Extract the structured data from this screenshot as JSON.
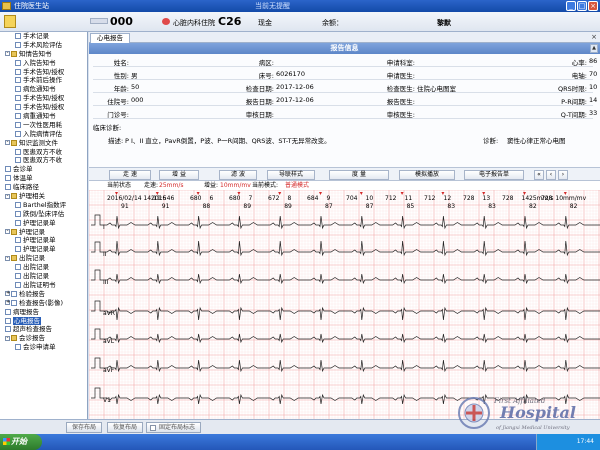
{
  "window": {
    "title": "住院医生站",
    "center_title": "当前无提醒"
  },
  "patient_bar": {
    "bed": "000",
    "dept": "心脏内科住院",
    "ward": "C26",
    "pay_type": "现金",
    "balance_label": "余额：",
    "name": "黎默"
  },
  "sidebar": {
    "items": [
      {
        "label": "手术记录",
        "indent": 3,
        "icon": "doc-icon",
        "expander": ""
      },
      {
        "label": "手术风险评估",
        "indent": 3,
        "icon": "doc-icon",
        "expander": ""
      },
      {
        "label": "知情告知书",
        "indent": 1,
        "icon": "folder-icon",
        "expander": "-"
      },
      {
        "label": "入院告知书",
        "indent": 3,
        "icon": "doc-icon",
        "expander": ""
      },
      {
        "label": "手术告知/授权",
        "indent": 3,
        "icon": "doc-icon",
        "expander": ""
      },
      {
        "label": "手术前后操作",
        "indent": 3,
        "icon": "doc-icon",
        "expander": ""
      },
      {
        "label": "病危通知书",
        "indent": 3,
        "icon": "doc-icon",
        "expander": ""
      },
      {
        "label": "手术告知/授权",
        "indent": 3,
        "icon": "doc-icon",
        "expander": ""
      },
      {
        "label": "手术告知/授权",
        "indent": 3,
        "icon": "doc-icon",
        "expander": ""
      },
      {
        "label": "病重通知书",
        "indent": 3,
        "icon": "doc-icon",
        "expander": ""
      },
      {
        "label": "一次性医用耗",
        "indent": 3,
        "icon": "doc-icon",
        "expander": ""
      },
      {
        "label": "入院病情评估",
        "indent": 3,
        "icon": "doc-icon",
        "expander": ""
      },
      {
        "label": "知识监测文件",
        "indent": 1,
        "icon": "folder-icon",
        "expander": "-"
      },
      {
        "label": "医患双方不收",
        "indent": 3,
        "icon": "doc-icon",
        "expander": ""
      },
      {
        "label": "医患双方不收",
        "indent": 3,
        "icon": "doc-icon",
        "expander": ""
      },
      {
        "label": "会诊单",
        "indent": 1,
        "icon": "doc-icon",
        "expander": ""
      },
      {
        "label": "体温单",
        "indent": 1,
        "icon": "doc-icon",
        "expander": ""
      },
      {
        "label": "临床路径",
        "indent": 1,
        "icon": "doc-icon",
        "expander": ""
      },
      {
        "label": "护理相关",
        "indent": 1,
        "icon": "folder-icon",
        "expander": "-"
      },
      {
        "label": "Barthel指数评",
        "indent": 3,
        "icon": "doc-icon",
        "expander": ""
      },
      {
        "label": "跌倒/坠床评估",
        "indent": 3,
        "icon": "doc-icon",
        "expander": ""
      },
      {
        "label": "护理记录单",
        "indent": 3,
        "icon": "doc-icon",
        "expander": ""
      },
      {
        "label": "护理记录",
        "indent": 1,
        "icon": "folder-icon",
        "expander": "-"
      },
      {
        "label": "护理记录单",
        "indent": 3,
        "icon": "doc-icon",
        "expander": ""
      },
      {
        "label": "护理记录单",
        "indent": 3,
        "icon": "doc-icon",
        "expander": ""
      },
      {
        "label": "出院记录",
        "indent": 1,
        "icon": "folder-icon",
        "expander": "-"
      },
      {
        "label": "出院记录",
        "indent": 3,
        "icon": "doc-icon",
        "expander": ""
      },
      {
        "label": "出院记录",
        "indent": 3,
        "icon": "doc-icon",
        "expander": ""
      },
      {
        "label": "出院证明书",
        "indent": 3,
        "icon": "doc-icon",
        "expander": ""
      },
      {
        "label": "检验报告",
        "indent": 1,
        "icon": "doc-icon",
        "expander": "+"
      },
      {
        "label": "检查报告(影像)",
        "indent": 1,
        "icon": "doc-icon",
        "expander": "+"
      },
      {
        "label": "病理报告",
        "indent": 1,
        "icon": "doc-icon",
        "expander": ""
      },
      {
        "label": "心电报告",
        "indent": 1,
        "icon": "doc-icon",
        "expander": "",
        "selected": true
      },
      {
        "label": "超声检查报告",
        "indent": 1,
        "icon": "doc-icon",
        "expander": ""
      },
      {
        "label": "会诊报告",
        "indent": 1,
        "icon": "folder-icon",
        "expander": "-"
      },
      {
        "label": "会诊申请单",
        "indent": 3,
        "icon": "doc-icon",
        "expander": ""
      }
    ]
  },
  "tab": {
    "label": "心电报告",
    "close": "×"
  },
  "report": {
    "header": "报告信息",
    "fields_left": [
      {
        "label": "姓名:",
        "value": ""
      },
      {
        "label": "性别:",
        "value": "男"
      },
      {
        "label": "年龄:",
        "value": "50"
      },
      {
        "label": "住院号:",
        "value": "000"
      },
      {
        "label": "门诊号:",
        "value": ""
      }
    ],
    "fields_mid": [
      {
        "label": "病区:",
        "value": ""
      },
      {
        "label": "床号:",
        "value": "6026170"
      },
      {
        "label": "检查日期:",
        "value": "2017-12-06"
      },
      {
        "label": "报告日期:",
        "value": "2017-12-06"
      },
      {
        "label": "审核日期:",
        "value": ""
      }
    ],
    "fields_right": [
      {
        "label": "申请科室:",
        "value": ""
      },
      {
        "label": "申请医生:",
        "value": ""
      },
      {
        "label": "检查医生:",
        "value": "住院心电图室"
      },
      {
        "label": "报告医生:",
        "value": ""
      },
      {
        "label": "审核医生:",
        "value": ""
      }
    ],
    "fields_far": [
      {
        "label": "心率:",
        "value": "86"
      },
      {
        "label": "电轴:",
        "value": "70"
      },
      {
        "label": "QRS时限:",
        "value": "10"
      },
      {
        "label": "P-R间期:",
        "value": "14"
      },
      {
        "label": "Q-T间期:",
        "value": "33"
      }
    ],
    "clinical_label": "临床诊断:",
    "desc_label": "描述:",
    "desc_value": "P I、II 直立，PavR倒置，P波、P一R间期、QRS波、ST-T无异常改变。",
    "diag_label": "诊断:",
    "diag_value": "窦性心律正常心电图"
  },
  "ecg_toolbar": {
    "buttons": [
      "走 速",
      "增 益",
      "滤 波",
      "导联样式",
      "度 量",
      "模拟播放",
      "电子报告单"
    ]
  },
  "ecg_status": {
    "state": "当前状态",
    "speed_label": "走速:",
    "speed": "25mm/s",
    "gain_label": "增益:",
    "gain": "10mm/mv",
    "mode_label": "当前模式:",
    "mode": "普通模式"
  },
  "ecg": {
    "leads": [
      "I",
      "II",
      "III",
      "aVR",
      "aVL",
      "aVF",
      "V1"
    ],
    "rr_top": [
      "2016",
      "6",
      "680",
      "6",
      "680",
      "7",
      "672",
      "8",
      "684",
      "9",
      "704",
      "10",
      "712",
      "11",
      "712",
      "12",
      "728",
      "13",
      "728",
      "14",
      "728"
    ],
    "hr_row": [
      "91",
      "91",
      "88",
      "89",
      "89",
      "87",
      "87",
      "85",
      "83",
      "83",
      "82",
      "82"
    ],
    "overlay_text": "2016/02/14 14:11:54",
    "overlay_right": "25mm/s  10mm/mv"
  },
  "bottom_buttons": [
    "保存布局",
    "恢复布局",
    "固定布局标志"
  ],
  "taskbar": {
    "start": "开始",
    "clock": "17:44"
  },
  "logo": {
    "line1": "First Affiliated",
    "line2": "Hospital",
    "line3": "of Jiangxi Medical University"
  },
  "colors": {
    "titlebar": "#2457b8",
    "report_header": "#5d86c8",
    "ecg_grid_major": "#f2a6a6",
    "ecg_grid_minor": "#fbe3e3",
    "ecg_trace": "#222222",
    "mode_text": "#d42a2a"
  }
}
